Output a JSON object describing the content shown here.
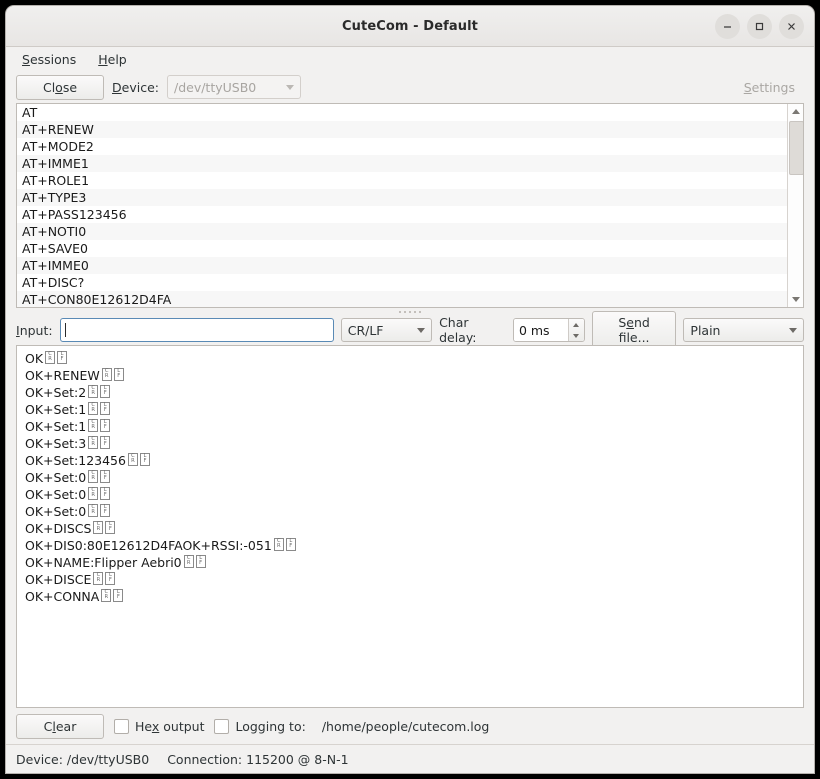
{
  "window": {
    "title": "CuteCom - Default",
    "controls": {
      "minimize": "minimize-icon",
      "maximize": "maximize-icon",
      "close": "close-icon"
    }
  },
  "menubar": {
    "items": [
      {
        "label": "Sessions",
        "mnemonic": "S"
      },
      {
        "label": "Help",
        "mnemonic": "H"
      }
    ]
  },
  "toolbar": {
    "close_label": "Close",
    "device_label": "Device:",
    "device_value": "/dev/ttyUSB0",
    "device_enabled": false,
    "settings_label": "Settings",
    "settings_enabled": false
  },
  "command_list": {
    "items": [
      "AT",
      "AT+RENEW",
      "AT+MODE2",
      "AT+IMME1",
      "AT+ROLE1",
      "AT+TYPE3",
      "AT+PASS123456",
      "AT+NOTI0",
      "AT+SAVE0",
      "AT+IMME0",
      "AT+DISC?",
      "AT+CON80E12612D4FA"
    ],
    "scrollbar": {
      "up_arrow": "scroll-up-icon",
      "down_arrow": "scroll-down-icon"
    }
  },
  "input_row": {
    "input_label": "Input:",
    "input_value": "",
    "input_placeholder": "",
    "line_ending": "CR/LF",
    "char_delay_label": "Char delay:",
    "char_delay_value": "0 ms",
    "send_file_label": "Send file...",
    "format": "Plain"
  },
  "output": {
    "lines": [
      "OK",
      "OK+RENEW",
      "OK+Set:2",
      "OK+Set:1",
      "OK+Set:1",
      "OK+Set:3",
      "OK+Set:123456",
      "OK+Set:0",
      "OK+Set:0",
      "OK+Set:0",
      "OK+DISCS",
      "OK+DIS0:80E12612D4FAOK+RSSI:-051",
      "OK+NAME:Flipper Aebri0",
      "OK+DISCE",
      "OK+CONNA"
    ],
    "line_terminator_glyphs": [
      "CR",
      "LF"
    ]
  },
  "bottom_bar": {
    "clear_label": "Clear",
    "hex_output_label": "Hex output",
    "hex_output_checked": false,
    "logging_label": "Logging to:",
    "logging_checked": false,
    "log_path": "/home/people/cutecom.log"
  },
  "statusbar": {
    "device_text": "Device:  /dev/ttyUSB0",
    "connection_text": "Connection:  115200 @ 8-N-1"
  },
  "colors": {
    "window_bg": "#f2f1f0",
    "field_bg": "#ffffff",
    "alt_row": "#f7f7f7",
    "border": "#bfbbb6",
    "focus_border": "#5a8ab5",
    "text": "#2e3436",
    "disabled_text": "#a8a5a1"
  }
}
